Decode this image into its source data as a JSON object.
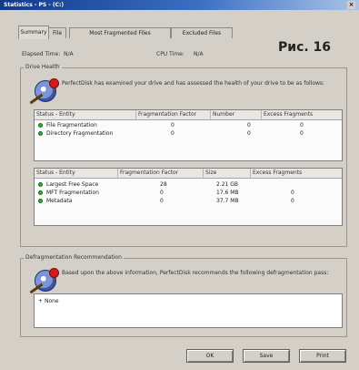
{
  "window": {
    "title": "Statistics - PS - (C:)",
    "close_glyph": "×"
  },
  "tabs": [
    {
      "label": "Summary",
      "active": true
    },
    {
      "label": "File"
    },
    {
      "label": "Most Fragmented Files"
    },
    {
      "label": "Excluded Files"
    }
  ],
  "figure_label": "Рис. 16",
  "info": {
    "elapsed_label": "Elapsed Time:",
    "elapsed_value": "N/A",
    "cpu_label": "CPU Time:",
    "cpu_value": "N/A"
  },
  "drive_health": {
    "title": "Drive Health",
    "description": "PerfectDisk has examined your drive and has assessed the health of your drive to be as follows:",
    "icon": "disk-check-icon",
    "table1": {
      "columns": [
        "Status - Entity",
        "Fragmentation Factor",
        "Number",
        "Excess Fragments"
      ],
      "rows": [
        {
          "status_color": "#2fae2f",
          "entity": "File Fragmentation",
          "factor": "0",
          "number": "0",
          "excess": "0"
        },
        {
          "status_color": "#2fae2f",
          "entity": "Directory Fragmentation",
          "factor": "0",
          "number": "0",
          "excess": "0"
        }
      ]
    },
    "table2": {
      "columns": [
        "Status - Entity",
        "Fragmentation Factor",
        "Size",
        "Excess Fragments"
      ],
      "rows": [
        {
          "status_color": "#2fae2f",
          "entity": "Largest Free Space",
          "factor": "28",
          "size": "2.21 GB",
          "excess": ""
        },
        {
          "status_color": "#2fae2f",
          "entity": "MFT Fragmentation",
          "factor": "0",
          "size": "17.6 MB",
          "excess": "0"
        },
        {
          "status_color": "#2fae2f",
          "entity": "Metadata",
          "factor": "0",
          "size": "37.7 MB",
          "excess": "0"
        }
      ]
    }
  },
  "recommendation": {
    "title": "Defragmentation Recommendation",
    "description": "Based upon the above information, PerfectDisk recommends the following defragmentation pass:",
    "icon": "disk-check-icon",
    "items": [
      "None"
    ],
    "item_prefix": "+"
  },
  "buttons": {
    "ok": "OK",
    "save": "Save",
    "print": "Print"
  }
}
